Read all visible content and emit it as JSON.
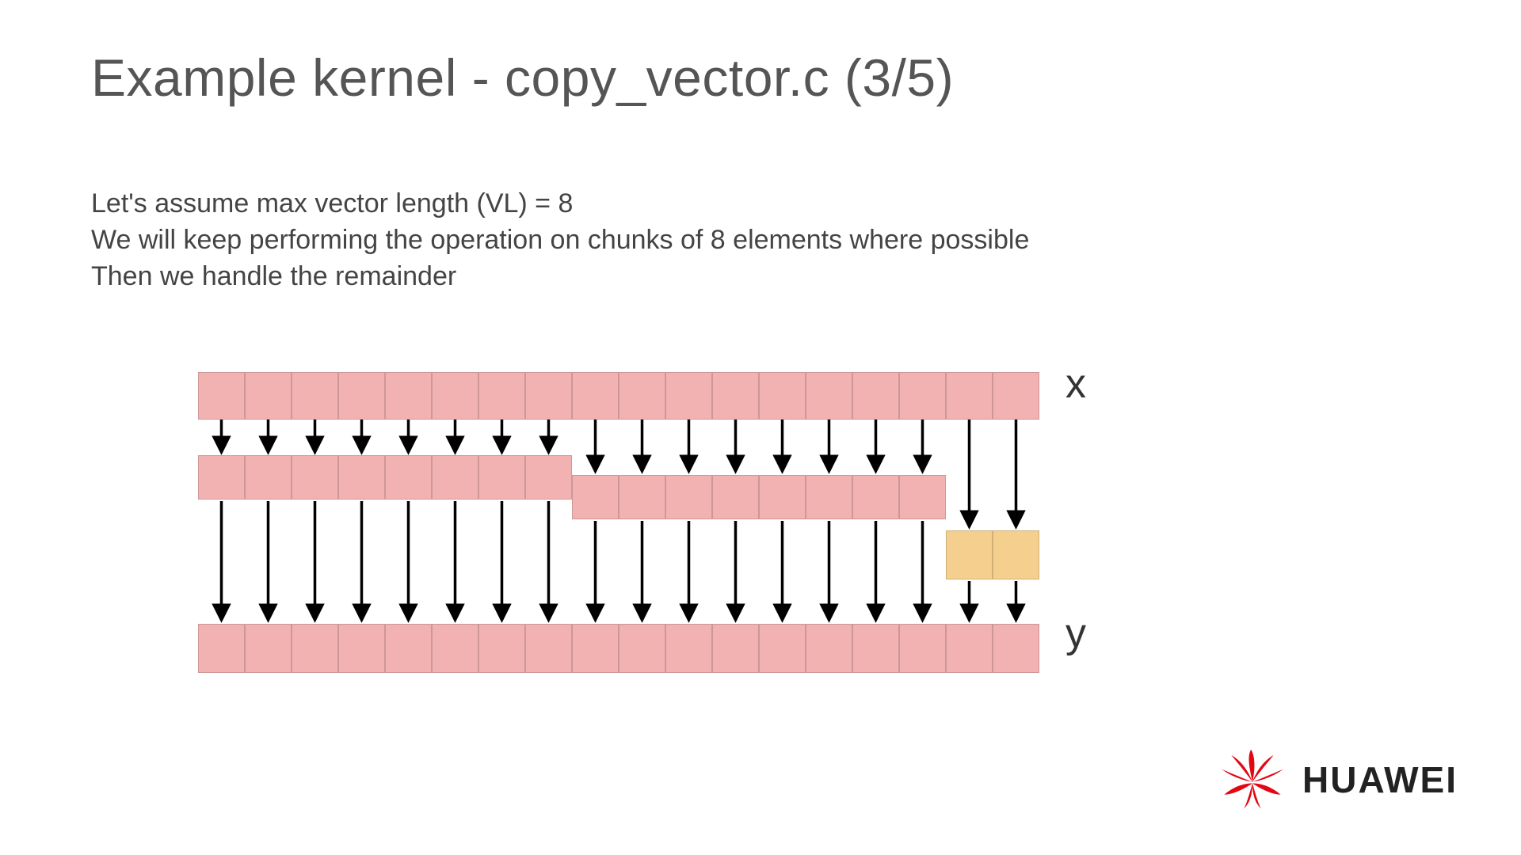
{
  "title": "Example kernel - copy_vector.c (3/5)",
  "body": {
    "line1": "Let's assume max vector length (VL) = 8",
    "line2": "We will keep performing the operation on chunks of 8 elements where possible",
    "line3": "Then we handle the remainder"
  },
  "diagram": {
    "label_x": "x",
    "label_y": "y",
    "total_elements": 18,
    "vector_length": 8,
    "chunks": [
      {
        "start": 0,
        "count": 8,
        "type": "full"
      },
      {
        "start": 8,
        "count": 8,
        "type": "full"
      },
      {
        "start": 16,
        "count": 2,
        "type": "remainder"
      }
    ],
    "colors": {
      "full": "#f2b2b2",
      "remainder": "#f5cf8e"
    }
  },
  "logo": {
    "text": "HUAWEI"
  }
}
